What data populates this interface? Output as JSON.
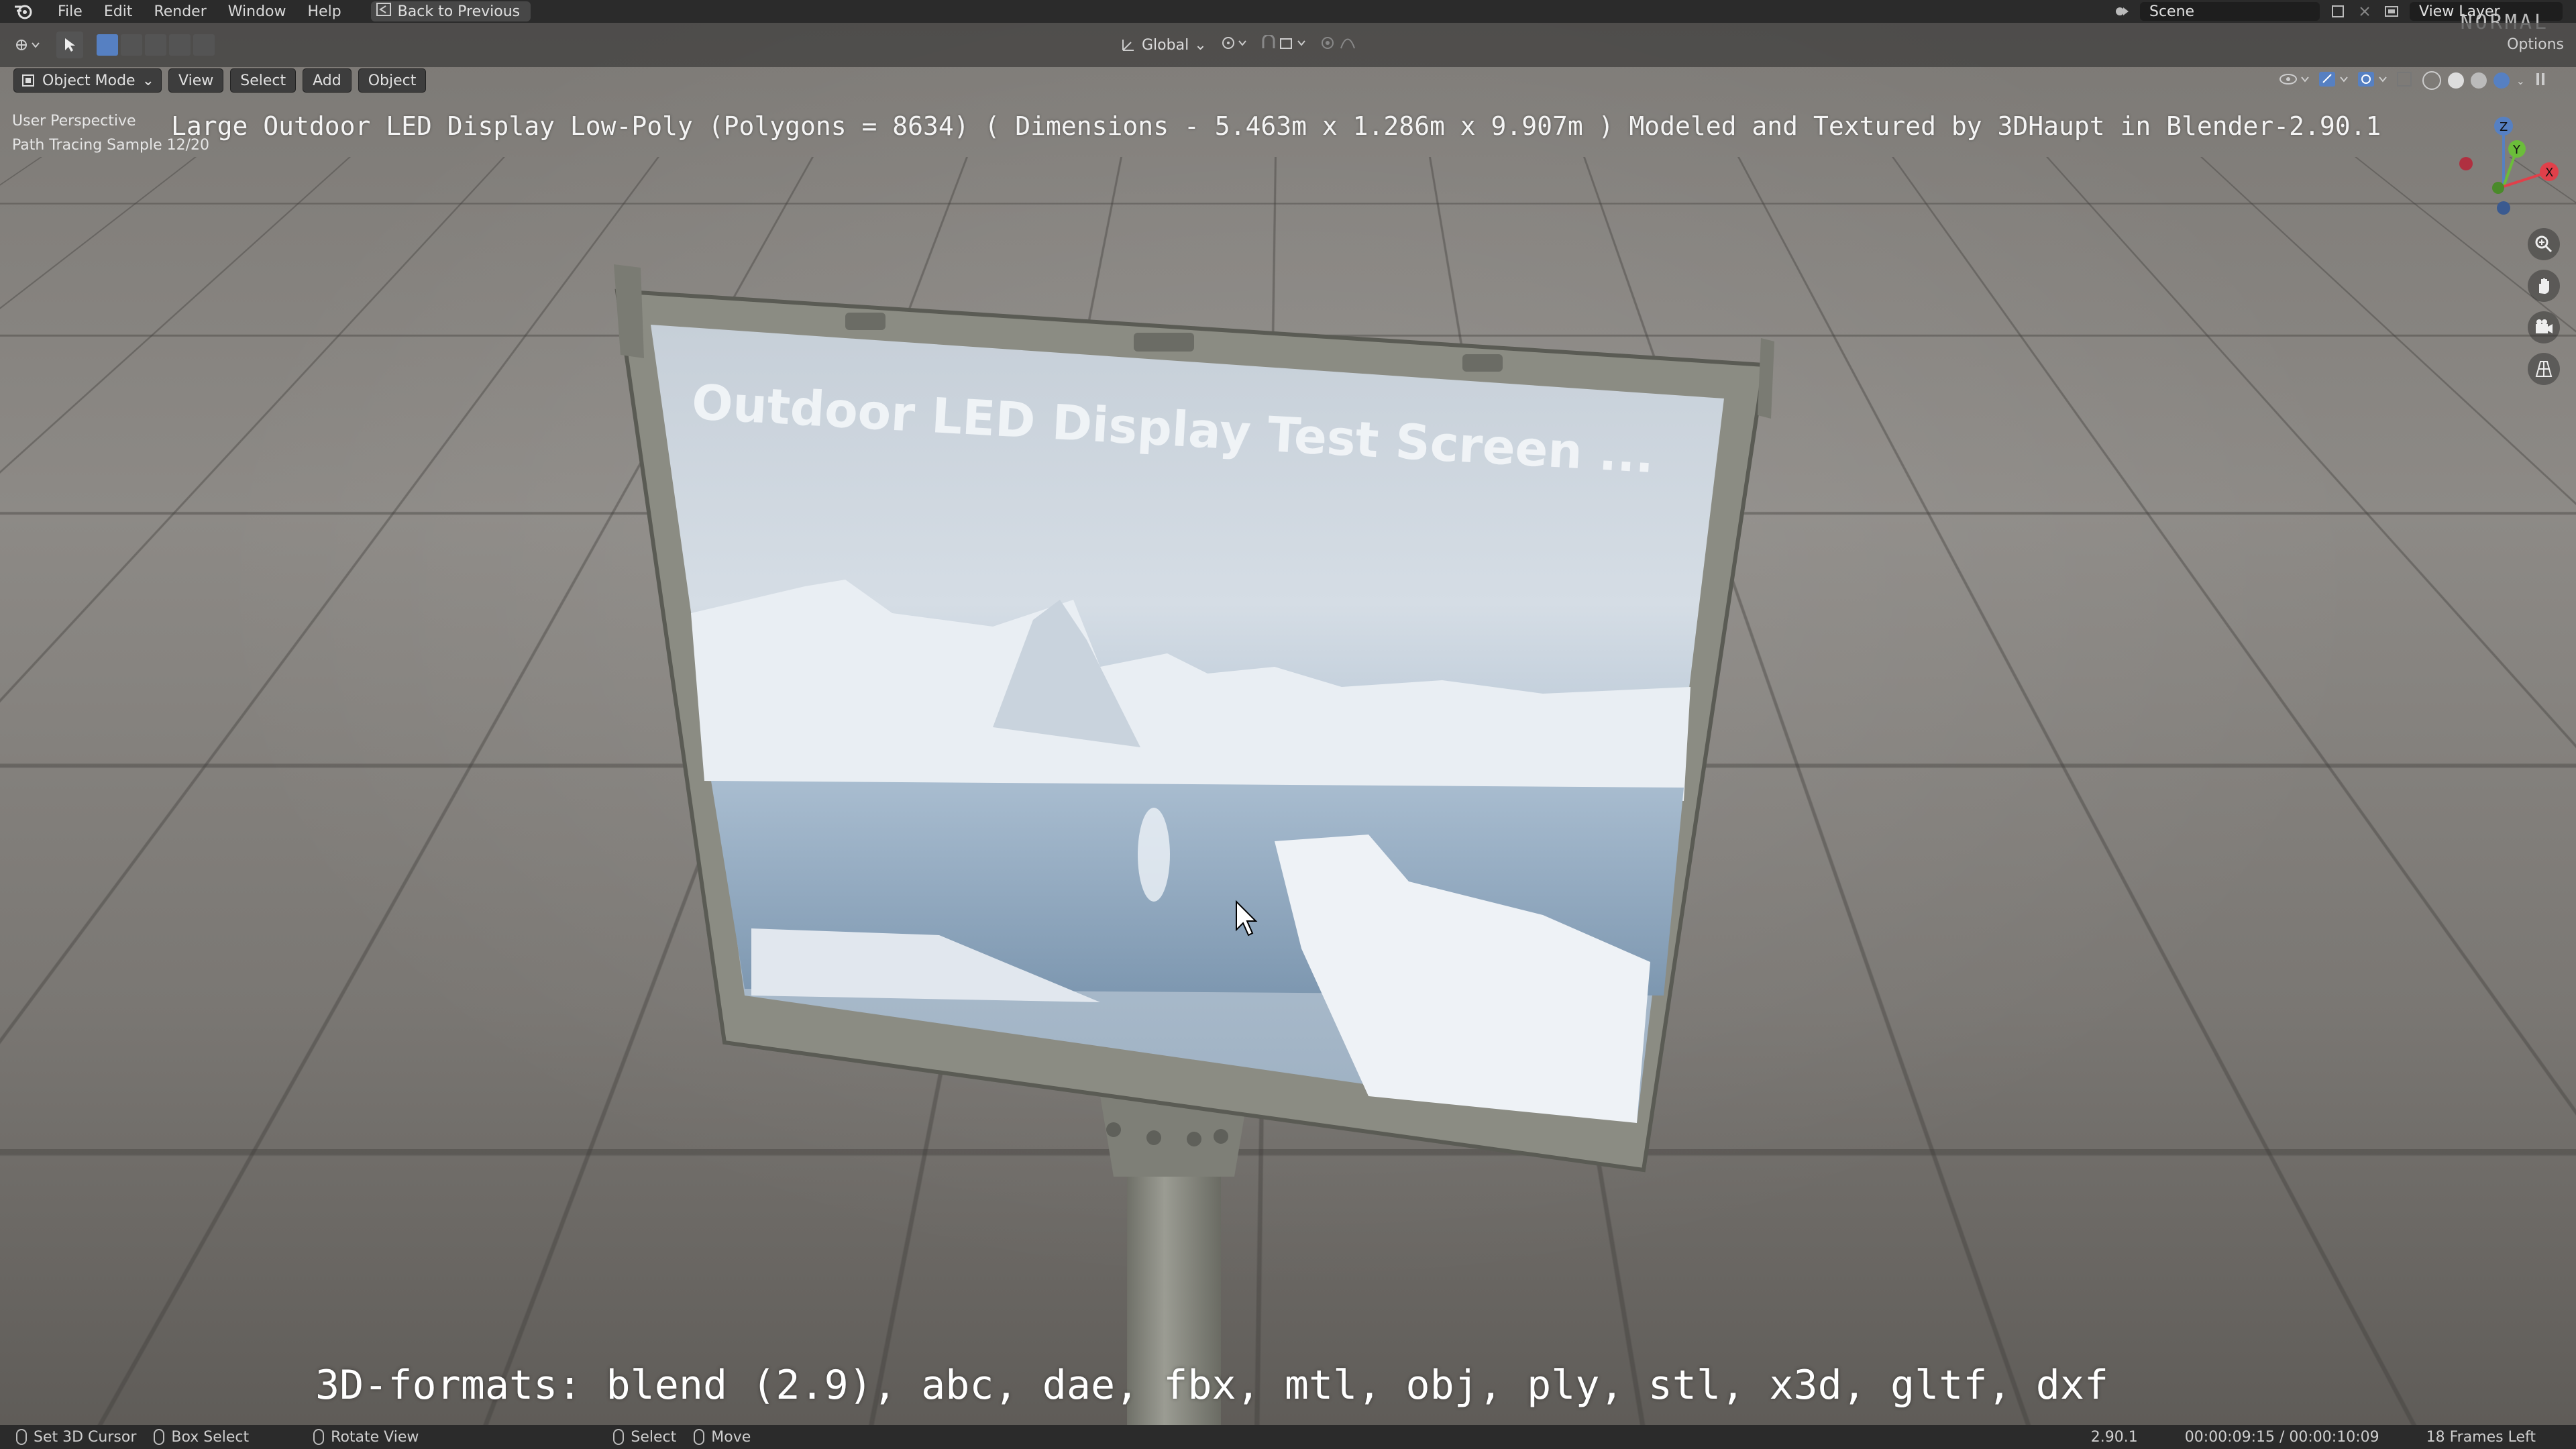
{
  "topbar": {
    "menus": [
      "File",
      "Edit",
      "Render",
      "Window",
      "Help"
    ],
    "back_label": "Back to Previous",
    "scene_label": "Scene",
    "view_layer_label": "View Layer",
    "normal_badge": "NORMAL",
    "options_label": "Options"
  },
  "header": {
    "orientation_label": "Global"
  },
  "viewport_header": {
    "mode_label": "Object Mode",
    "view_label": "View",
    "select_label": "Select",
    "add_label": "Add",
    "object_label": "Object"
  },
  "viewport": {
    "perspective_label": "User Perspective",
    "render_status": "Path Tracing Sample 12/20",
    "title": "Large Outdoor LED Display Low-Poly (Polygons = 8634) ( Dimensions -  5.463m x 1.286m x 9.907m ) Modeled and Textured by 3DHaupt in Blender-2.90.1",
    "screen_text": "Outdoor LED Display Test Screen ...",
    "formats_text": "3D-formats: blend (2.9), abc, dae, fbx, mtl, obj, ply, stl, x3d, gltf, dxf",
    "gizmo_labels": {
      "z": "Z",
      "y": "Y",
      "x": "X"
    }
  },
  "statusbar": {
    "set_cursor_label": "Set 3D Cursor",
    "box_select_label": "Box Select",
    "rotate_view_label": "Rotate View",
    "select_label": "Select",
    "move_label": "Move",
    "version": "2.90.1",
    "time": "00:00:09:15 / 00:00:10:09",
    "frames_left": "18 Frames Left"
  },
  "colors": {
    "accent": "#5680c2",
    "topbar_bg": "#2b2b2b",
    "frame": "#8b8c83"
  }
}
